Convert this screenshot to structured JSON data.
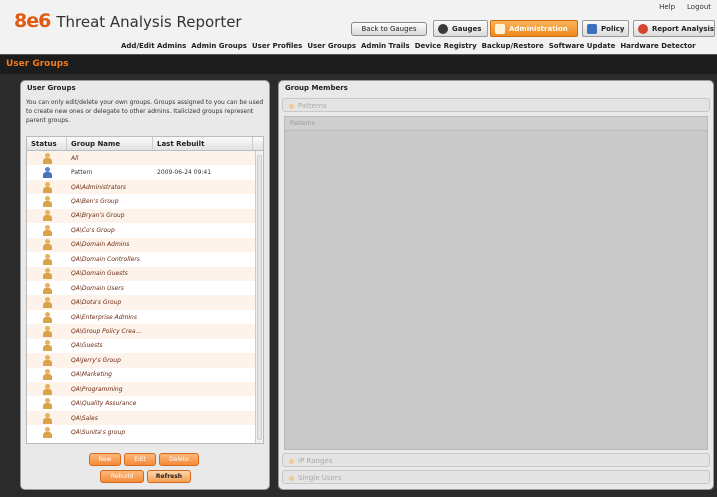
{
  "app": {
    "logo": "8e6",
    "title": "Threat Analysis Reporter"
  },
  "top_links": {
    "help": "Help",
    "logout": "Logout"
  },
  "header": {
    "back_button": "Back to Gauges"
  },
  "tabs": [
    {
      "label": "Gauges",
      "icon": "gauge-icon",
      "color": "#3a3a3a"
    },
    {
      "label": "Administration",
      "icon": "admin-icon",
      "color": "#ef8a1e"
    },
    {
      "label": "Policy",
      "icon": "policy-icon",
      "color": "#3d6fbf"
    },
    {
      "label": "Report Analysis",
      "icon": "report-icon",
      "color": "#d5452b"
    }
  ],
  "subnav": [
    "Add/Edit Admins",
    "Admin Groups",
    "User Profiles",
    "User Groups",
    "Admin Trails",
    "Device Registry",
    "Backup/Restore",
    "Software Update",
    "Hardware Detector"
  ],
  "page_title": "User Groups",
  "left_panel": {
    "title": "User Groups",
    "description": "You can only edit/delete your own groups.  Groups assigned to you can be used to create new ones or delegate to other admins. Italicized groups represent parent groups.",
    "columns": [
      "Status",
      "Group Name",
      "Last Rebuilt"
    ],
    "rows": [
      {
        "name": "All",
        "rebuilt": "",
        "italic": true,
        "icon": "user-icon"
      },
      {
        "name": "Pattern",
        "rebuilt": "2009-06-24 09:41",
        "italic": false,
        "icon": "user-blue-icon"
      },
      {
        "name": "QA\\Administrators",
        "rebuilt": "",
        "italic": true,
        "icon": "user-icon"
      },
      {
        "name": "QA\\Ben's Group",
        "rebuilt": "",
        "italic": true,
        "icon": "user-icon"
      },
      {
        "name": "QA\\Bryan's Group",
        "rebuilt": "",
        "italic": true,
        "icon": "user-icon"
      },
      {
        "name": "QA\\Co's Group",
        "rebuilt": "",
        "italic": true,
        "icon": "user-icon"
      },
      {
        "name": "QA\\Domain Admins",
        "rebuilt": "",
        "italic": true,
        "icon": "user-icon"
      },
      {
        "name": "QA\\Domain Controllers",
        "rebuilt": "",
        "italic": true,
        "icon": "user-icon"
      },
      {
        "name": "QA\\Domain Guests",
        "rebuilt": "",
        "italic": true,
        "icon": "user-icon"
      },
      {
        "name": "QA\\Domain Users",
        "rebuilt": "",
        "italic": true,
        "icon": "user-icon"
      },
      {
        "name": "QA\\Dota's Group",
        "rebuilt": "",
        "italic": true,
        "icon": "user-icon"
      },
      {
        "name": "QA\\Enterprise Admins",
        "rebuilt": "",
        "italic": true,
        "icon": "user-icon"
      },
      {
        "name": "QA\\Group Policy Crea...",
        "rebuilt": "",
        "italic": true,
        "icon": "user-icon"
      },
      {
        "name": "QA\\Guests",
        "rebuilt": "",
        "italic": true,
        "icon": "user-icon"
      },
      {
        "name": "QA\\Jerry's Group",
        "rebuilt": "",
        "italic": true,
        "icon": "user-icon"
      },
      {
        "name": "QA\\Marketing",
        "rebuilt": "",
        "italic": true,
        "icon": "user-icon"
      },
      {
        "name": "QA\\Programming",
        "rebuilt": "",
        "italic": true,
        "icon": "user-icon"
      },
      {
        "name": "QA\\Quality Assurance",
        "rebuilt": "",
        "italic": true,
        "icon": "user-icon"
      },
      {
        "name": "QA\\Sales",
        "rebuilt": "",
        "italic": true,
        "icon": "user-icon"
      },
      {
        "name": "QA\\Sunita's group",
        "rebuilt": "",
        "italic": true,
        "icon": "user-icon"
      }
    ],
    "buttons": {
      "new": "New",
      "edit": "Edit",
      "delete": "Delete",
      "rebuild": "Rebuild",
      "refresh": "Refresh"
    }
  },
  "right_panel": {
    "title": "Group Members",
    "sections": {
      "patterns": "Patterns",
      "patterns_sub": "Patterns",
      "ip_ranges": "IP Ranges",
      "single_users": "Single Users"
    }
  }
}
